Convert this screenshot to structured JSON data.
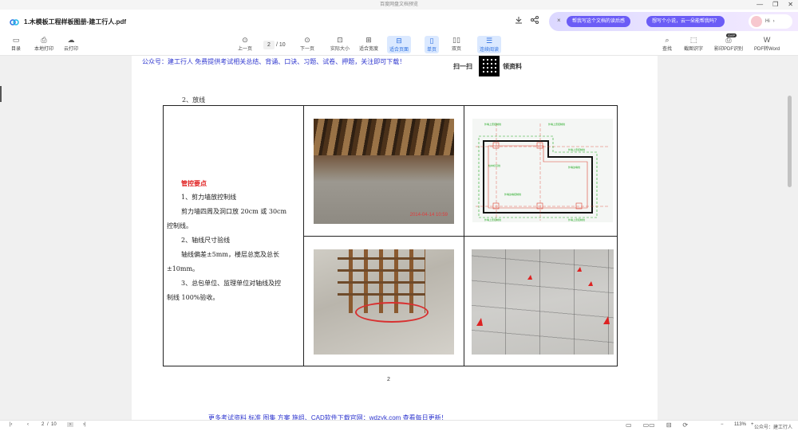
{
  "window": {
    "title": "百度网盘文档预览",
    "controls": [
      "—",
      "❐",
      "✕"
    ]
  },
  "file": {
    "name": "1.木模板工程样板图册-建工行人.pdf"
  },
  "ai": {
    "close": "×",
    "suggestions": [
      "帮我写这个文档的读后感",
      "想写个小说，云一朵能帮我吗？"
    ],
    "greeting": "Hi",
    "greeting_arrow": "›"
  },
  "toolbar": {
    "left": [
      {
        "icon": "▭",
        "label": "目录"
      },
      {
        "icon": "⎙",
        "label": "本地打印"
      },
      {
        "icon": "☁",
        "label": "云打印"
      }
    ],
    "prev_label": "上一页",
    "next_label": "下一页",
    "current_page": "2",
    "page_sep": "/",
    "total_pages": "10",
    "view": [
      {
        "icon": "⊡",
        "label": "实际大小"
      },
      {
        "icon": "⊞",
        "label": "适合宽度"
      },
      {
        "icon": "⊟",
        "label": "适合页面"
      },
      {
        "icon": "▯",
        "label": "单页"
      },
      {
        "icon": "▯▯",
        "label": "双页"
      },
      {
        "icon": "☰",
        "label": "连续阅读"
      }
    ],
    "right": [
      {
        "icon": "⌕",
        "label": "查找"
      },
      {
        "icon": "⬚",
        "label": "截图识字"
      },
      {
        "icon": "⎙",
        "label": "影印PDF识别"
      },
      {
        "icon": "W",
        "label": "PDF转Word"
      }
    ],
    "svip_badge": "SVIP"
  },
  "document": {
    "header_text": "公众号：建工行人 免费提供考试相关总结、背诵、口诀、习题、试卷、押题，关注即可下载！",
    "qr_left": "扫一扫",
    "qr_right": "领资料",
    "section_title": "2、放线",
    "control_title": "管控要点",
    "lines": [
      "1、剪力墙放控制线",
      "剪力墙四周及洞口放 20cm 或 30cm",
      "控制线。",
      "2、轴线尺寸验线",
      "轴线偏差±5mm，楼层总宽及总长",
      "±10mm。",
      "3、总包单位、监理单位对轴线及控",
      "制线 100%验收。"
    ],
    "photo_timestamp": "2014-04-14 10:59",
    "diagram_labels": [
      "外墙上皮控制线",
      "外墙上皮控制线",
      "外墙上皮控制线",
      "外墙上皮控制线",
      "外墙边墙控制线",
      "外墙上皮控制线",
      "外墙边墙线",
      "外墙上皮控制线",
      "外墙上皮控制线",
      "柱中标识线"
    ],
    "page_number": "2",
    "footer_text": "更多考试资料 标准 图集 方案 施组、CAD软件下载官网：wdzyk.com 查看每日更新！"
  },
  "status": {
    "current_page": "2",
    "total_pages": "10",
    "zoom": "113%",
    "zoom_minus": "−",
    "zoom_plus": "+",
    "watermark": "公众号：建工行人"
  },
  "colors": {
    "accent": "#2c6fe0",
    "ai_pill": "#6b5cf6",
    "link_blue": "#2e36cf",
    "red": "#e02020"
  }
}
